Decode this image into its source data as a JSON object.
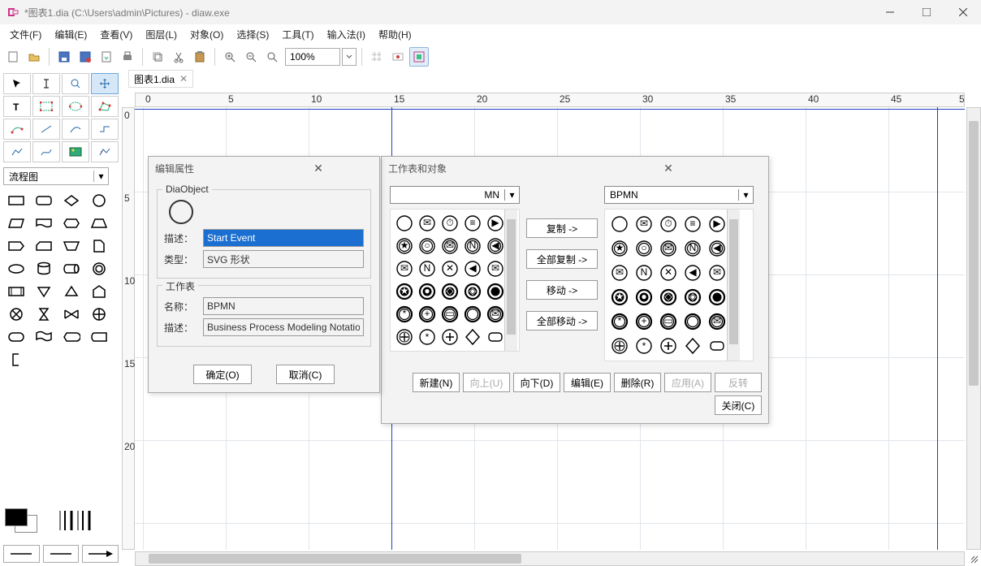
{
  "window": {
    "title": "*图表1.dia (C:\\Users\\admin\\Pictures) - diaw.exe"
  },
  "menu": {
    "file": "文件(F)",
    "edit": "编辑(E)",
    "view": "查看(V)",
    "layers": "图层(L)",
    "objects": "对象(O)",
    "select": "选择(S)",
    "tools": "工具(T)",
    "input": "输入法(I)",
    "help": "帮助(H)"
  },
  "toolbar": {
    "zoom": "100%"
  },
  "toolbox": {
    "category": "流程图"
  },
  "tab": {
    "label": "图表1.dia"
  },
  "ruler_h": [
    "0",
    "5",
    "10",
    "15",
    "20",
    "25",
    "30",
    "35",
    "40",
    "45",
    "5"
  ],
  "ruler_v": [
    "0",
    "5",
    "10",
    "15",
    "20"
  ],
  "dialog_props": {
    "title": "编辑属性",
    "group_obj": "DiaObject",
    "desc_label": "描述：",
    "desc_value": "Start Event",
    "type_label": "类型：",
    "type_value": "SVG 形状",
    "group_sheet": "工作表",
    "name_label": "名称：",
    "name_value": "BPMN",
    "sheet_desc_label": "描述：",
    "sheet_desc_value": "Business Process Modeling Notation",
    "ok": "确定(O)",
    "cancel": "取消(C)"
  },
  "dialog_sheets": {
    "title": "工作表和对象",
    "left_select": "MN",
    "right_select": "BPMN",
    "copy": "复制 ->",
    "copy_all": "全部复制 ->",
    "move": "移动 ->",
    "move_all": "全部移动 ->",
    "new": "新建(N)",
    "up": "向上(U)",
    "down": "向下(D)",
    "edit": "编辑(E)",
    "delete": "删除(R)",
    "apply": "应用(A)",
    "revert": "反转",
    "close": "关闭(C)"
  }
}
